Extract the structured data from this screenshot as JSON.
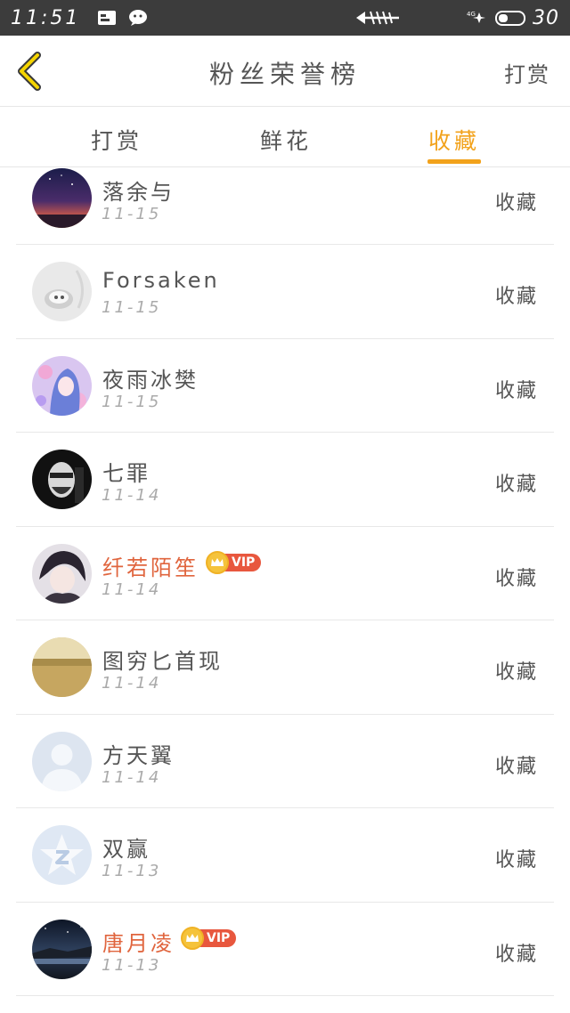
{
  "status_bar": {
    "time": "11:51",
    "battery": "30"
  },
  "nav": {
    "title": "粉丝荣誉榜",
    "right_label": "打赏"
  },
  "tabs": [
    {
      "label": "打赏",
      "active": false
    },
    {
      "label": "鲜花",
      "active": false
    },
    {
      "label": "收藏",
      "active": true
    }
  ],
  "colors": {
    "accent": "#f2a21b",
    "vip_name": "#e0653e",
    "vip_tag": "#e8573e"
  },
  "fans": [
    {
      "name": "落余与",
      "date": "11-15",
      "action": "收藏",
      "vip": false,
      "avatar": "sunset-sky-avatar"
    },
    {
      "name": "Forsaken",
      "date": "11-15",
      "action": "收藏",
      "vip": false,
      "avatar": "cat-avatar"
    },
    {
      "name": "夜雨冰樊",
      "date": "11-15",
      "action": "收藏",
      "vip": false,
      "avatar": "anime-girl-avatar"
    },
    {
      "name": "七罪",
      "date": "11-14",
      "action": "收藏",
      "vip": false,
      "avatar": "masked-man-avatar"
    },
    {
      "name": "纤若陌笙",
      "date": "11-14",
      "action": "收藏",
      "vip": true,
      "vip_label": "VIP",
      "avatar": "anime-boy-avatar"
    },
    {
      "name": "图穷匕首现",
      "date": "11-14",
      "action": "收藏",
      "vip": false,
      "avatar": "field-avatar"
    },
    {
      "name": "方天翼",
      "date": "11-14",
      "action": "收藏",
      "vip": false,
      "avatar": "default-person-avatar"
    },
    {
      "name": "双赢",
      "date": "11-13",
      "action": "收藏",
      "vip": false,
      "avatar": "qzone-star-avatar"
    },
    {
      "name": "唐月凌",
      "date": "11-13",
      "action": "收藏",
      "vip": true,
      "vip_label": "VIP",
      "avatar": "night-lake-avatar"
    }
  ]
}
